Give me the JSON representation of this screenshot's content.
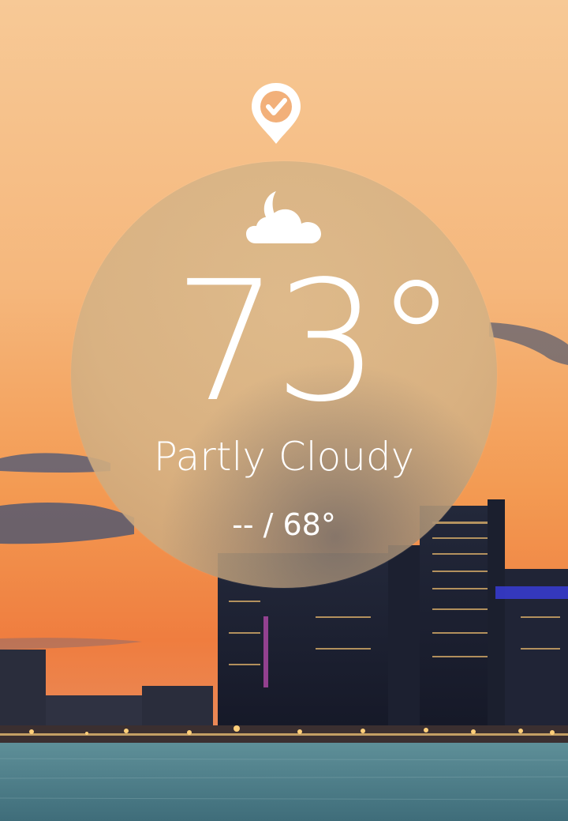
{
  "weather": {
    "temperature": "73°",
    "condition": "Partly Cloudy",
    "high_low": "-- / 68°",
    "condition_icon": "partly-cloudy-night-icon",
    "location_icon": "location-check-icon"
  },
  "colors": {
    "sky_top": "#f6c38f",
    "sky_bottom": "#f07e3d",
    "disc": "#d8b886",
    "water": "#4f7e8a",
    "text": "#ffffff"
  }
}
